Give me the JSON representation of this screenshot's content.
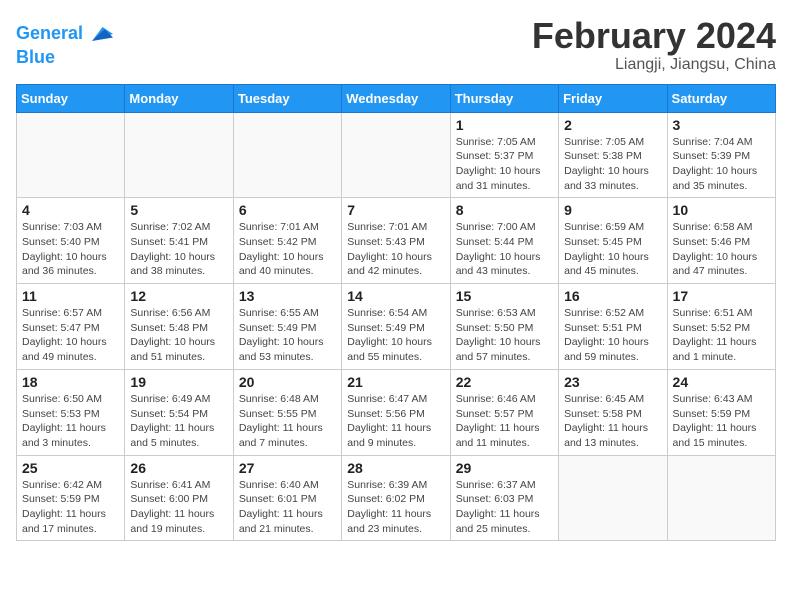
{
  "header": {
    "logo_line1": "General",
    "logo_line2": "Blue",
    "title": "February 2024",
    "subtitle": "Liangji, Jiangsu, China"
  },
  "weekdays": [
    "Sunday",
    "Monday",
    "Tuesday",
    "Wednesday",
    "Thursday",
    "Friday",
    "Saturday"
  ],
  "weeks": [
    [
      {
        "day": "",
        "info": ""
      },
      {
        "day": "",
        "info": ""
      },
      {
        "day": "",
        "info": ""
      },
      {
        "day": "",
        "info": ""
      },
      {
        "day": "1",
        "info": "Sunrise: 7:05 AM\nSunset: 5:37 PM\nDaylight: 10 hours\nand 31 minutes."
      },
      {
        "day": "2",
        "info": "Sunrise: 7:05 AM\nSunset: 5:38 PM\nDaylight: 10 hours\nand 33 minutes."
      },
      {
        "day": "3",
        "info": "Sunrise: 7:04 AM\nSunset: 5:39 PM\nDaylight: 10 hours\nand 35 minutes."
      }
    ],
    [
      {
        "day": "4",
        "info": "Sunrise: 7:03 AM\nSunset: 5:40 PM\nDaylight: 10 hours\nand 36 minutes."
      },
      {
        "day": "5",
        "info": "Sunrise: 7:02 AM\nSunset: 5:41 PM\nDaylight: 10 hours\nand 38 minutes."
      },
      {
        "day": "6",
        "info": "Sunrise: 7:01 AM\nSunset: 5:42 PM\nDaylight: 10 hours\nand 40 minutes."
      },
      {
        "day": "7",
        "info": "Sunrise: 7:01 AM\nSunset: 5:43 PM\nDaylight: 10 hours\nand 42 minutes."
      },
      {
        "day": "8",
        "info": "Sunrise: 7:00 AM\nSunset: 5:44 PM\nDaylight: 10 hours\nand 43 minutes."
      },
      {
        "day": "9",
        "info": "Sunrise: 6:59 AM\nSunset: 5:45 PM\nDaylight: 10 hours\nand 45 minutes."
      },
      {
        "day": "10",
        "info": "Sunrise: 6:58 AM\nSunset: 5:46 PM\nDaylight: 10 hours\nand 47 minutes."
      }
    ],
    [
      {
        "day": "11",
        "info": "Sunrise: 6:57 AM\nSunset: 5:47 PM\nDaylight: 10 hours\nand 49 minutes."
      },
      {
        "day": "12",
        "info": "Sunrise: 6:56 AM\nSunset: 5:48 PM\nDaylight: 10 hours\nand 51 minutes."
      },
      {
        "day": "13",
        "info": "Sunrise: 6:55 AM\nSunset: 5:49 PM\nDaylight: 10 hours\nand 53 minutes."
      },
      {
        "day": "14",
        "info": "Sunrise: 6:54 AM\nSunset: 5:49 PM\nDaylight: 10 hours\nand 55 minutes."
      },
      {
        "day": "15",
        "info": "Sunrise: 6:53 AM\nSunset: 5:50 PM\nDaylight: 10 hours\nand 57 minutes."
      },
      {
        "day": "16",
        "info": "Sunrise: 6:52 AM\nSunset: 5:51 PM\nDaylight: 10 hours\nand 59 minutes."
      },
      {
        "day": "17",
        "info": "Sunrise: 6:51 AM\nSunset: 5:52 PM\nDaylight: 11 hours\nand 1 minute."
      }
    ],
    [
      {
        "day": "18",
        "info": "Sunrise: 6:50 AM\nSunset: 5:53 PM\nDaylight: 11 hours\nand 3 minutes."
      },
      {
        "day": "19",
        "info": "Sunrise: 6:49 AM\nSunset: 5:54 PM\nDaylight: 11 hours\nand 5 minutes."
      },
      {
        "day": "20",
        "info": "Sunrise: 6:48 AM\nSunset: 5:55 PM\nDaylight: 11 hours\nand 7 minutes."
      },
      {
        "day": "21",
        "info": "Sunrise: 6:47 AM\nSunset: 5:56 PM\nDaylight: 11 hours\nand 9 minutes."
      },
      {
        "day": "22",
        "info": "Sunrise: 6:46 AM\nSunset: 5:57 PM\nDaylight: 11 hours\nand 11 minutes."
      },
      {
        "day": "23",
        "info": "Sunrise: 6:45 AM\nSunset: 5:58 PM\nDaylight: 11 hours\nand 13 minutes."
      },
      {
        "day": "24",
        "info": "Sunrise: 6:43 AM\nSunset: 5:59 PM\nDaylight: 11 hours\nand 15 minutes."
      }
    ],
    [
      {
        "day": "25",
        "info": "Sunrise: 6:42 AM\nSunset: 5:59 PM\nDaylight: 11 hours\nand 17 minutes."
      },
      {
        "day": "26",
        "info": "Sunrise: 6:41 AM\nSunset: 6:00 PM\nDaylight: 11 hours\nand 19 minutes."
      },
      {
        "day": "27",
        "info": "Sunrise: 6:40 AM\nSunset: 6:01 PM\nDaylight: 11 hours\nand 21 minutes."
      },
      {
        "day": "28",
        "info": "Sunrise: 6:39 AM\nSunset: 6:02 PM\nDaylight: 11 hours\nand 23 minutes."
      },
      {
        "day": "29",
        "info": "Sunrise: 6:37 AM\nSunset: 6:03 PM\nDaylight: 11 hours\nand 25 minutes."
      },
      {
        "day": "",
        "info": ""
      },
      {
        "day": "",
        "info": ""
      }
    ]
  ]
}
